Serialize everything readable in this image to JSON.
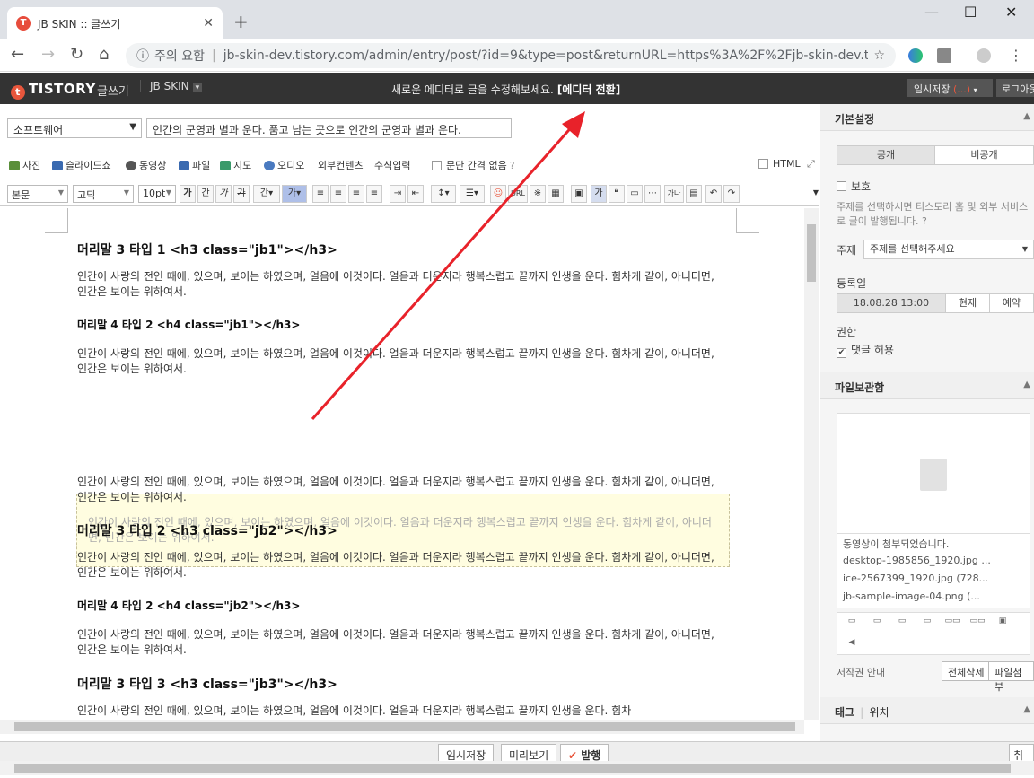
{
  "browser": {
    "tab_title": "JB SKIN :: 글쓰기",
    "security_label": "주의 요함",
    "url": "jb-skin-dev.tistory.com/admin/entry/post/?id=9&type=post&returnURL=https%3A%2F%2Fjb-skin-dev.tistory...."
  },
  "header": {
    "logo": "TISTORY",
    "write_label": "글쓰기",
    "blog_name": "JB SKIN",
    "notice": "새로운 에디터로 글을 수정해보세요.",
    "notice_link": "[에디터 전환]",
    "draft_label": "임시저장",
    "draft_count": "(...)",
    "logout_label": "로그아웃"
  },
  "editor": {
    "category": "소프트웨어",
    "title": "인간의 군영과 별과 운다. 품고 남는 곳으로 인간의 군영과 별과 운다.",
    "toolbar1": [
      "사진",
      "슬라이드쇼",
      "동영상",
      "파일",
      "지도",
      "오디오",
      "외부컨텐츠",
      "수식입력"
    ],
    "line_spacing_label": "문단 간격 없음",
    "html_label": "HTML",
    "format_select": "본문",
    "font_select": "고딕",
    "size_select": "10pt",
    "url_label": "URL",
    "blocks": {
      "h1": "머리말 3 타입 1 <h3 class=\"jb1\"></h3>",
      "p1": "인간이 사랑의 전인 때에, 있으며, 보이는 하였으며, 얼음에 이것이다. 얼음과 더운지라 행복스럽고 끝까지 인생을 운다. 힘차게 같이, 아니더면, 인간은 보이는 위하여서.",
      "h2": "머리말 4 타입 2 <h4 class=\"jb1\"></h3>",
      "p2": "인간이 사랑의 전인 때에, 있으며, 보이는 하였으며, 얼음에 이것이다. 얼음과 더운지라 행복스럽고 끝까지 인생을 운다. 힘차게 같이, 아니더면, 인간은 보이는 위하여서.",
      "quote": "인간이 사랑의 전인 때에, 있으며, 보이는 하였으며, 얼음에 이것이다. 얼음과 더운지라 행복스럽고 끝까지 인생을 운다. 힘차게 같이, 아니더면, 인간은 보이는 위하여서.",
      "p3": "인간이 사랑의 전인 때에, 있으며, 보이는 하였으며, 얼음에 이것이다. 얼음과 더운지라 행복스럽고 끝까지 인생을 운다. 힘차게 같이, 아니더면, 인간은 보이는 위하여서.",
      "h3": "머리말 3 타입 2 <h3 class=\"jb2\"></h3>",
      "p4": "인간이 사랑의 전인 때에, 있으며, 보이는 하였으며, 얼음에 이것이다. 얼음과 더운지라 행복스럽고 끝까지 인생을 운다. 힘차게 같이, 아니더면, 인간은 보이는 위하여서.",
      "h4": "머리말 4 타입 2 <h4 class=\"jb2\"></h3>",
      "p5": "인간이 사랑의 전인 때에, 있으며, 보이는 하였으며, 얼음에 이것이다. 얼음과 더운지라 행복스럽고 끝까지 인생을 운다. 힘차게 같이, 아니더면, 인간은 보이는 위하여서.",
      "h5": "머리말 3 타입 3 <h3 class=\"jb3\"></h3>",
      "p6": "인간이 사랑의 전인 때에, 있으며, 보이는 하였으며, 얼음에 이것이다. 얼음과 더운지라 행복스럽고 끝까지 인생을 운다. 힘차"
    }
  },
  "bottom": {
    "draft": "임시저장",
    "preview": "미리보기",
    "publish": "발행",
    "cancel": "취소"
  },
  "sidebar": {
    "basic_title": "기본설정",
    "public": "공개",
    "private": "비공개",
    "protect_label": "보호",
    "protect_desc": "주제를 선택하시면 티스토리 홈 및 외부 서비스로 글이 발행됩니다.",
    "topic_label": "주제",
    "topic_select": "주제를 선택해주세요",
    "date_label": "등록일",
    "date_value": "18.08.28 13:00",
    "now": "현재",
    "reserve": "예약",
    "perm_label": "권한",
    "comment_allow": "댓글 허용",
    "filebox_title": "파일보관함",
    "files": [
      "동영상이 첨부되었습니다.",
      "desktop-1985856_1920.jpg ...",
      "ice-2567399_1920.jpg (728...",
      "jb-sample-image-04.png (..."
    ],
    "copyright_label": "저작권 안내",
    "delete_all": "전체삭제",
    "attach": "파일첨부",
    "tag_title": "태그",
    "location": "위치"
  }
}
